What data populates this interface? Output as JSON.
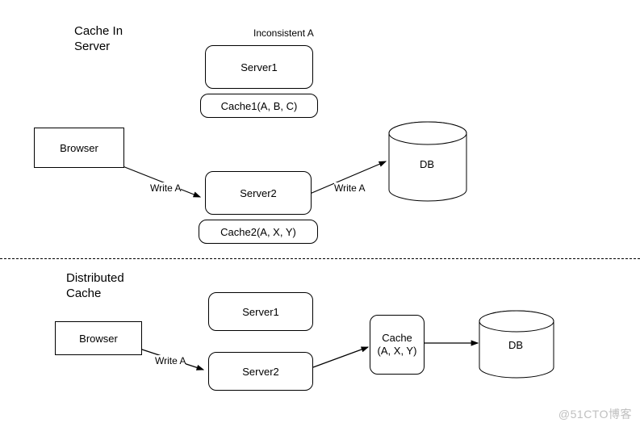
{
  "watermark": "@51CTO博客",
  "top": {
    "title_line1": "Cache In",
    "title_line2": "Server",
    "inconsistent": "Inconsistent A",
    "browser": "Browser",
    "server1": "Server1",
    "cache1": "Cache1(A, B, C)",
    "server2": "Server2",
    "cache2": "Cache2(A, X, Y)",
    "db": "DB",
    "write_a_left": "Write A",
    "write_a_right": "Write A"
  },
  "bottom": {
    "title_line1": "Distributed",
    "title_line2": "Cache",
    "browser": "Browser",
    "server1": "Server1",
    "server2": "Server2",
    "cache_line1": "Cache",
    "cache_line2": "(A, X, Y)",
    "db": "DB",
    "write_a": "Write A"
  }
}
